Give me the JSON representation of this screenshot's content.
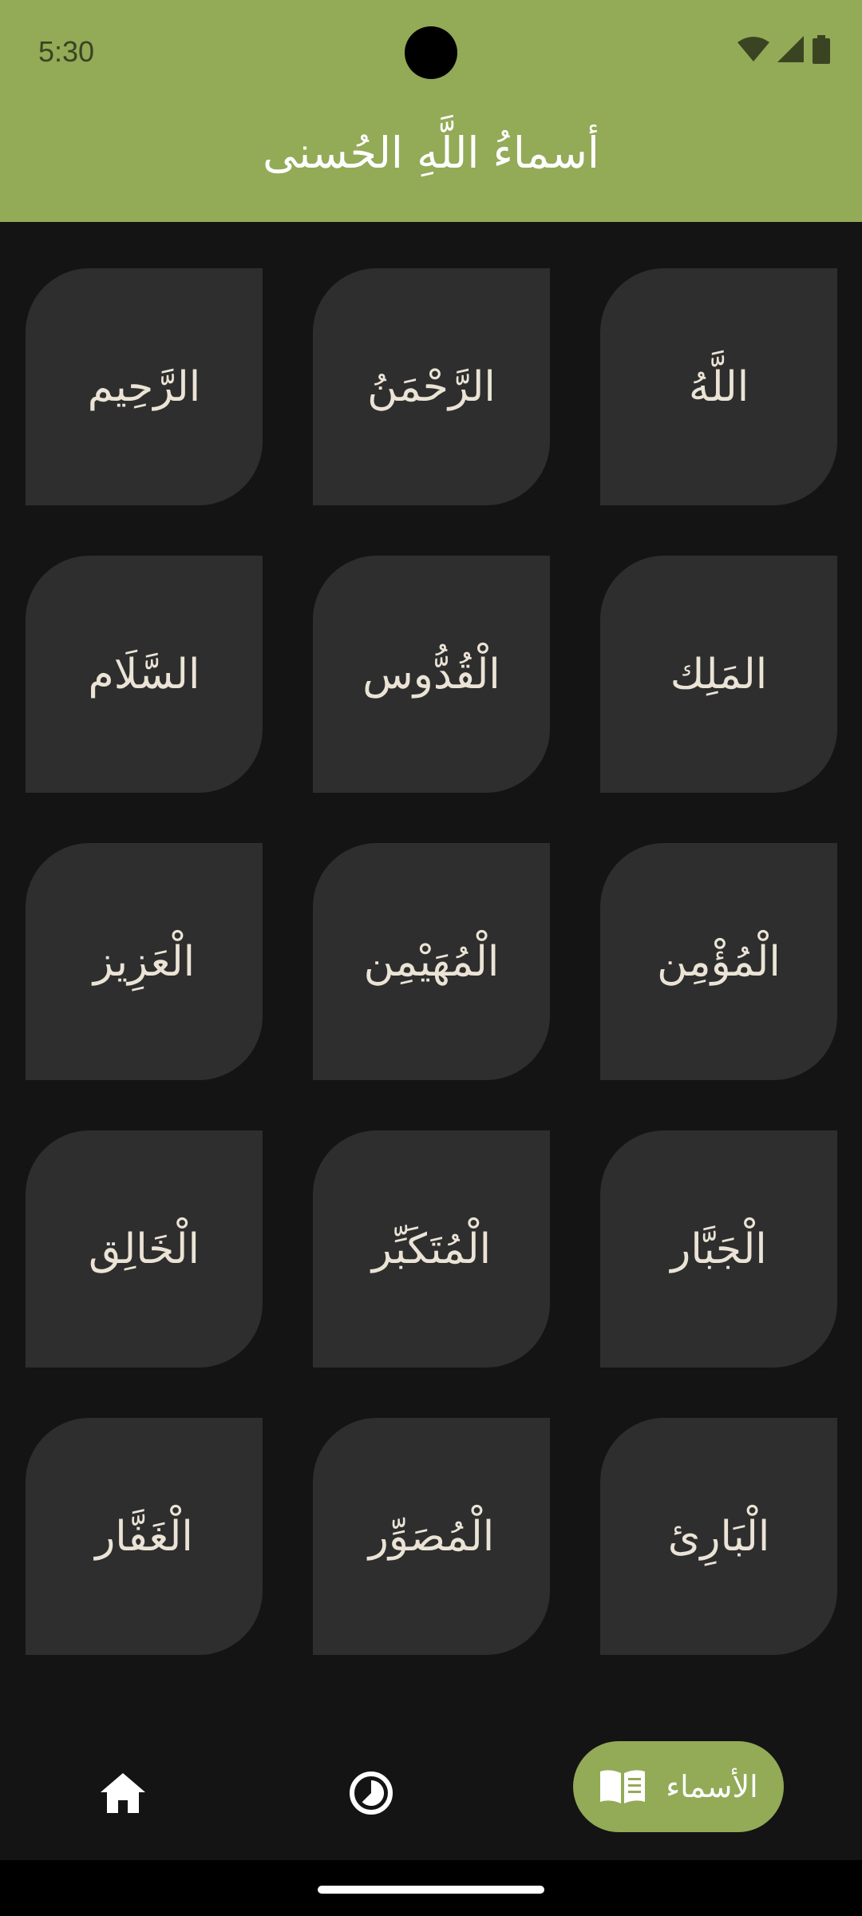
{
  "status_bar": {
    "time": "5:30"
  },
  "header": {
    "title": "أسماءُ اللَّهِ الحُسنى",
    "background_color": "#93aa57"
  },
  "names": [
    "اللَّهُ",
    "الرَّحْمَنُ",
    "الرَّحِيم",
    "المَلِك",
    "الْقُدُّوس",
    "السَّلَام",
    "الْمُؤْمِن",
    "الْمُهَيْمِن",
    "الْعَزِيز",
    "الْجَبَّار",
    "الْمُتَكَبِّر",
    "الْخَالِق",
    "الْبَارِئ",
    "الْمُصَوِّر",
    "الْغَفَّار"
  ],
  "bottom_nav": {
    "home_icon": "home-icon",
    "prayer_icon": "clock-icon",
    "names_icon": "book-icon",
    "names_label": "الأسماء",
    "active_color": "#93aa57"
  },
  "colors": {
    "background": "#141414",
    "tile": "#2e2e2e",
    "tile_text": "#ebe4d6"
  }
}
